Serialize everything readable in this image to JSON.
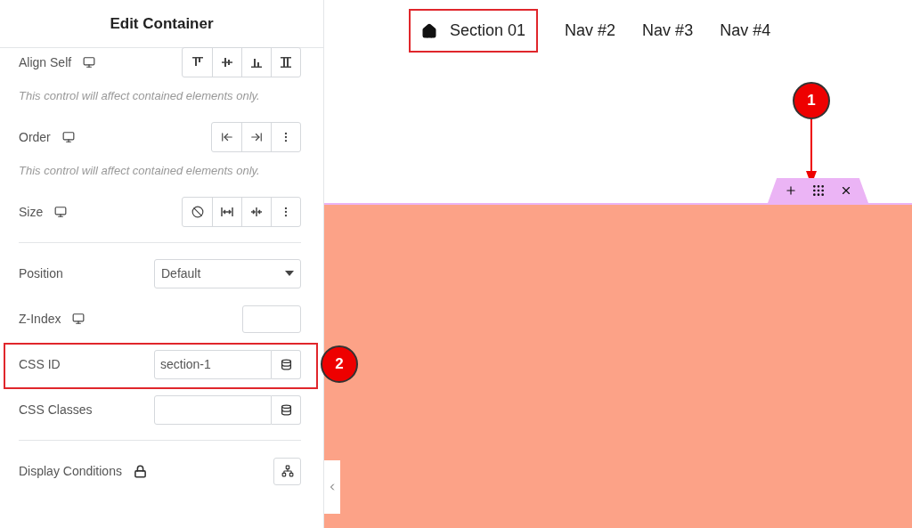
{
  "panel": {
    "title": "Edit Container",
    "controls": [
      {
        "kind": "align_group",
        "label": "Align Self",
        "responsive": true,
        "hint": "This control will affect contained elements only."
      },
      {
        "kind": "order_group",
        "label": "Order",
        "responsive": true,
        "hint": "This control will affect contained elements only."
      },
      {
        "kind": "size_group",
        "label": "Size",
        "responsive": true
      },
      {
        "kind": "divider"
      },
      {
        "kind": "select",
        "label": "Position",
        "value": "Default"
      },
      {
        "kind": "number",
        "label": "Z-Index",
        "responsive": true
      },
      {
        "kind": "dynamic_text",
        "label": "CSS ID",
        "value": "section-1",
        "highlighted": true,
        "callout": "2"
      },
      {
        "kind": "dynamic_text",
        "label": "CSS Classes"
      },
      {
        "kind": "divider"
      },
      {
        "kind": "conditions",
        "label": "Display Conditions",
        "locked": true
      }
    ]
  },
  "canvas": {
    "nav": [
      {
        "label": "Section 01",
        "home": true,
        "highlighted": true
      },
      {
        "label": "Nav #2",
        "home": false,
        "highlighted": false
      },
      {
        "label": "Nav #3",
        "home": false,
        "highlighted": false
      },
      {
        "label": "Nav #4",
        "home": false,
        "highlighted": false
      }
    ],
    "toolbar_callout": "1"
  }
}
